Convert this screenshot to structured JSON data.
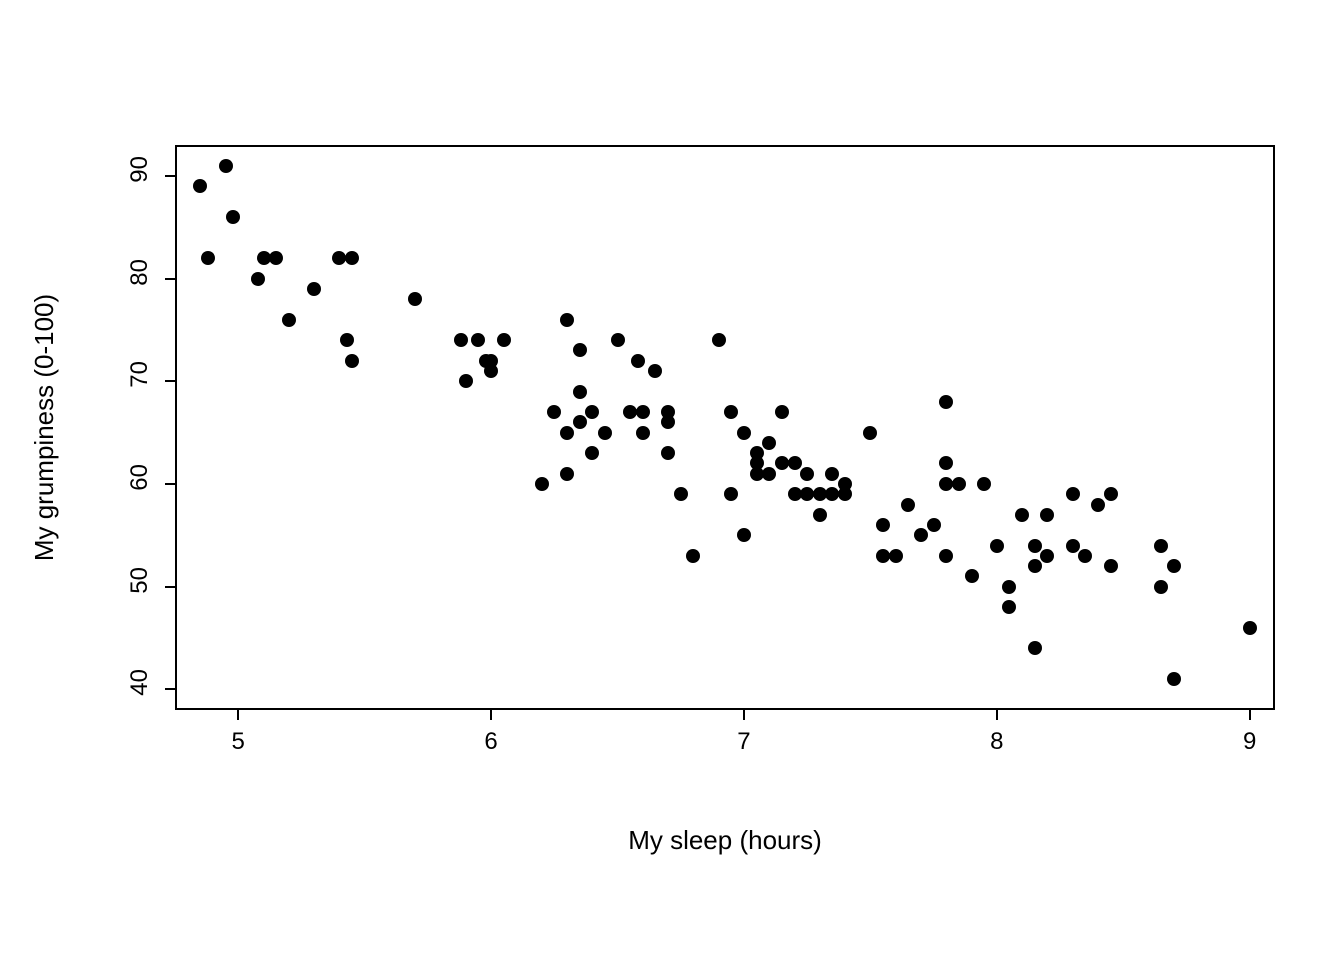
{
  "chart_data": {
    "type": "scatter",
    "xlabel": "My sleep (hours)",
    "ylabel": "My grumpiness (0-100)",
    "xlim": [
      4.75,
      9.1
    ],
    "ylim": [
      38,
      93
    ],
    "x_ticks": [
      5,
      6,
      7,
      8,
      9
    ],
    "y_ticks": [
      40,
      50,
      60,
      70,
      80,
      90
    ],
    "x": [
      4.85,
      4.95,
      4.88,
      4.98,
      5.1,
      5.15,
      5.08,
      5.2,
      5.3,
      5.4,
      5.45,
      5.45,
      5.43,
      5.7,
      5.88,
      5.9,
      5.95,
      6.0,
      6.0,
      5.98,
      6.05,
      6.2,
      6.25,
      6.3,
      6.3,
      6.3,
      6.35,
      6.35,
      6.35,
      6.4,
      6.4,
      6.45,
      6.5,
      6.55,
      6.58,
      6.6,
      6.6,
      6.65,
      6.7,
      6.7,
      6.7,
      6.75,
      6.8,
      6.9,
      6.95,
      6.95,
      7.0,
      7.0,
      7.05,
      7.05,
      7.05,
      7.1,
      7.1,
      7.15,
      7.15,
      7.2,
      7.2,
      7.25,
      7.25,
      7.3,
      7.3,
      7.35,
      7.35,
      7.4,
      7.4,
      7.5,
      7.55,
      7.55,
      7.6,
      7.65,
      7.7,
      7.75,
      7.8,
      7.8,
      7.8,
      7.8,
      7.85,
      7.9,
      7.95,
      8.0,
      8.05,
      8.05,
      8.1,
      8.15,
      8.15,
      8.15,
      8.2,
      8.2,
      8.3,
      8.3,
      8.35,
      8.4,
      8.45,
      8.45,
      8.65,
      8.65,
      8.7,
      8.7,
      9.0
    ],
    "y": [
      89,
      91,
      82,
      86,
      82,
      82,
      80,
      76,
      79,
      82,
      82,
      72,
      74,
      78,
      74,
      70,
      74,
      71,
      72,
      72,
      74,
      60,
      67,
      76,
      65,
      61,
      66,
      69,
      73,
      67,
      63,
      65,
      74,
      67,
      72,
      67,
      65,
      71,
      67,
      66,
      63,
      59,
      53,
      74,
      67,
      59,
      65,
      55,
      63,
      62,
      61,
      61,
      64,
      67,
      62,
      62,
      59,
      61,
      59,
      59,
      57,
      59,
      61,
      59,
      60,
      65,
      53,
      56,
      53,
      58,
      55,
      56,
      60,
      53,
      62,
      68,
      60,
      51,
      60,
      54,
      48,
      50,
      57,
      52,
      54,
      44,
      57,
      53,
      54,
      59,
      53,
      58,
      52,
      59,
      50,
      54,
      41,
      52,
      46
    ]
  }
}
